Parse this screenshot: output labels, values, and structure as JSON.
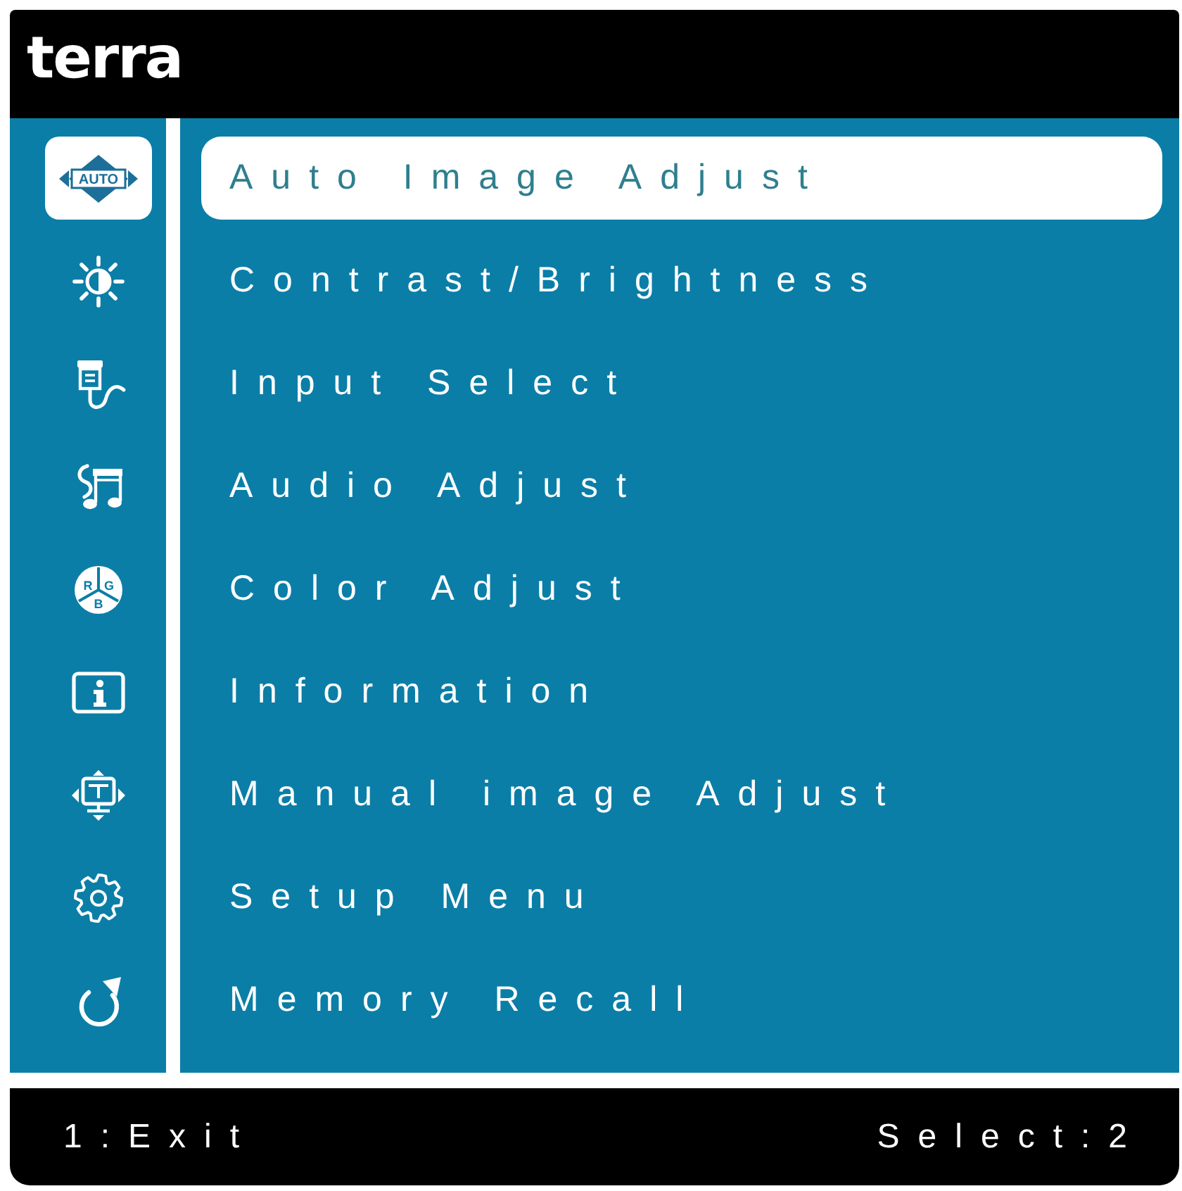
{
  "header": {
    "logo": "terra"
  },
  "menu": {
    "items": [
      {
        "label": "Auto Image Adjust",
        "selected": true,
        "icon_labels": [
          "AUTO"
        ]
      },
      {
        "label": "Contrast/Brightness",
        "selected": false
      },
      {
        "label": "Input Select",
        "selected": false
      },
      {
        "label": "Audio Adjust",
        "selected": false
      },
      {
        "label": "Color Adjust",
        "selected": false,
        "icon_labels": [
          "R",
          "G",
          "B"
        ]
      },
      {
        "label": "Information",
        "selected": false
      },
      {
        "label": "Manual image Adjust",
        "selected": false
      },
      {
        "label": "Setup Menu",
        "selected": false
      },
      {
        "label": "Memory Recall",
        "selected": false
      }
    ]
  },
  "footer": {
    "exit_hint": "1:Exit",
    "select_hint": "Select:2"
  }
}
